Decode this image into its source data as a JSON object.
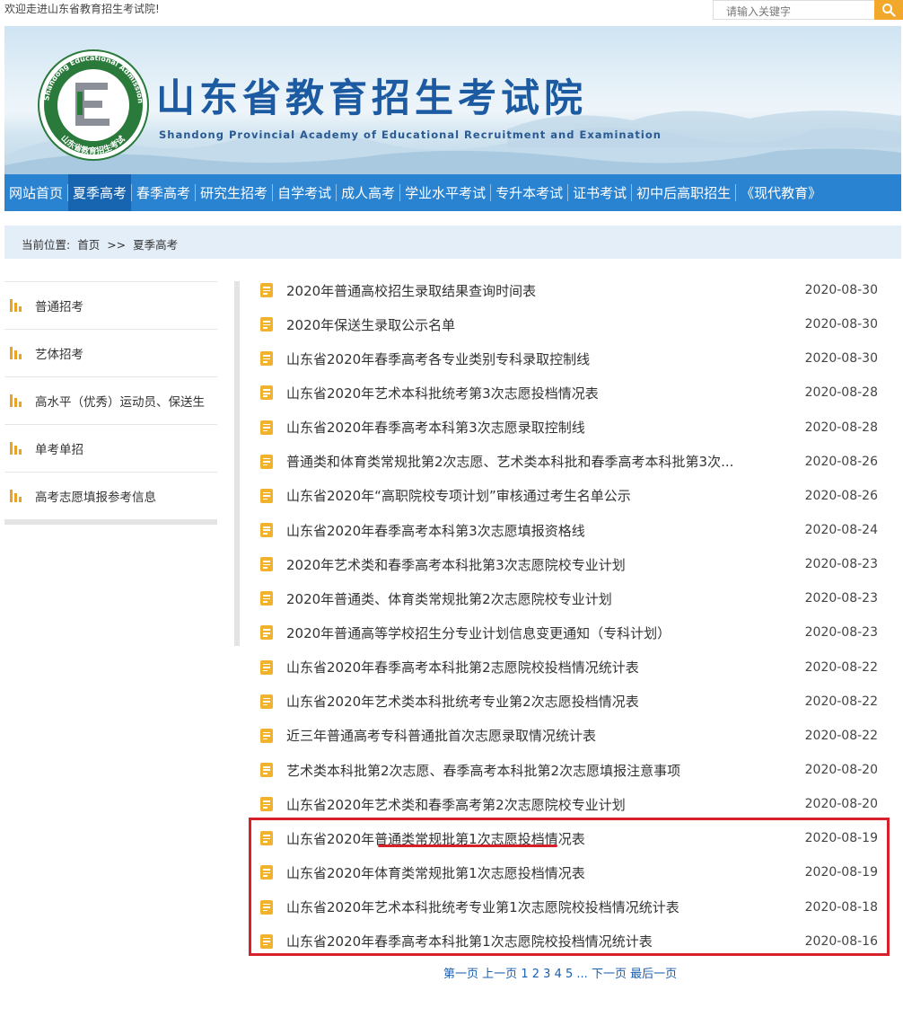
{
  "topbar": {
    "welcome": "欢迎走进山东省教育招生考试院!",
    "search_placeholder": "请输入关键字"
  },
  "banner": {
    "title": "山东省教育招生考试院",
    "subtitle": "Shandong Provincial Academy of Educational Recruitment and Examination",
    "logo_ring_text": "Shandong Educational Admission & Examinations",
    "logo_bottom_text": "山东省教育招生考试"
  },
  "nav": {
    "items": [
      {
        "label": "网站首页",
        "active": false
      },
      {
        "label": "夏季高考",
        "active": true
      },
      {
        "label": "春季高考",
        "active": false
      },
      {
        "label": "研究生招考",
        "active": false
      },
      {
        "label": "自学考试",
        "active": false
      },
      {
        "label": "成人高考",
        "active": false
      },
      {
        "label": "学业水平考试",
        "active": false
      },
      {
        "label": "专升本考试",
        "active": false
      },
      {
        "label": "证书考试",
        "active": false
      },
      {
        "label": "初中后高职招生",
        "active": false
      },
      {
        "label": "《现代教育》",
        "active": false
      }
    ]
  },
  "breadcrumb": {
    "prefix": "当前位置:",
    "home": "首页",
    "sep": ">>",
    "current": "夏季高考"
  },
  "sidebar": {
    "items": [
      {
        "label": "普通招考"
      },
      {
        "label": "艺体招考"
      },
      {
        "label": "高水平（优秀）运动员、保送生"
      },
      {
        "label": "单考单招"
      },
      {
        "label": "高考志愿填报参考信息"
      }
    ]
  },
  "list": {
    "items": [
      {
        "title": "2020年普通高校招生录取结果查询时间表",
        "date": "2020-08-30"
      },
      {
        "title": "2020年保送生录取公示名单",
        "date": "2020-08-30"
      },
      {
        "title": "山东省2020年春季高考各专业类别专科录取控制线",
        "date": "2020-08-30"
      },
      {
        "title": "山东省2020年艺术本科批统考第3次志愿投档情况表",
        "date": "2020-08-28"
      },
      {
        "title": "山东省2020年春季高考本科第3次志愿录取控制线",
        "date": "2020-08-28"
      },
      {
        "title": "普通类和体育类常规批第2次志愿、艺术类本科批和春季高考本科批第3次...",
        "date": "2020-08-26"
      },
      {
        "title": "山东省2020年“高职院校专项计划”审核通过考生名单公示",
        "date": "2020-08-26"
      },
      {
        "title": "山东省2020年春季高考本科第3次志愿填报资格线",
        "date": "2020-08-24"
      },
      {
        "title": "2020年艺术类和春季高考本科批第3次志愿院校专业计划",
        "date": "2020-08-23"
      },
      {
        "title": "2020年普通类、体育类常规批第2次志愿院校专业计划",
        "date": "2020-08-23"
      },
      {
        "title": "2020年普通高等学校招生分专业计划信息变更通知（专科计划）",
        "date": "2020-08-23"
      },
      {
        "title": "山东省2020年春季高考本科批第2志愿院校投档情况统计表",
        "date": "2020-08-22"
      },
      {
        "title": "山东省2020年艺术类本科批统考专业第2次志愿投档情况表",
        "date": "2020-08-22"
      },
      {
        "title": "近三年普通高考专科普通批首次志愿录取情况统计表",
        "date": "2020-08-22"
      },
      {
        "title": "艺术类本科批第2次志愿、春季高考本科批第2次志愿填报注意事项",
        "date": "2020-08-20"
      },
      {
        "title": "山东省2020年艺术类和春季高考第2次志愿院校专业计划",
        "date": "2020-08-20"
      },
      {
        "title": "山东省2020年普通类常规批第1次志愿投档情况表",
        "date": "2020-08-19"
      },
      {
        "title": "山东省2020年体育类常规批第1次志愿投档情况表",
        "date": "2020-08-19"
      },
      {
        "title": "山东省2020年艺术本科批统考专业第1次志愿院校投档情况统计表",
        "date": "2020-08-18"
      },
      {
        "title": "山东省2020年春季高考本科批第1次志愿院校投档情况统计表",
        "date": "2020-08-16"
      }
    ]
  },
  "pager": {
    "first": "第一页",
    "prev": "上一页",
    "pages": [
      "1",
      "2",
      "3",
      "4",
      "5"
    ],
    "ellipsis": "...",
    "next": "下一页",
    "last": "最后一页"
  },
  "colors": {
    "nav_bg": "#2a83d0",
    "nav_active": "#1765b0",
    "title_blue": "#1c5aa2",
    "icon_orange": "#f1b32e",
    "highlight_red": "#d6202a",
    "link_blue": "#1b5fb0"
  }
}
